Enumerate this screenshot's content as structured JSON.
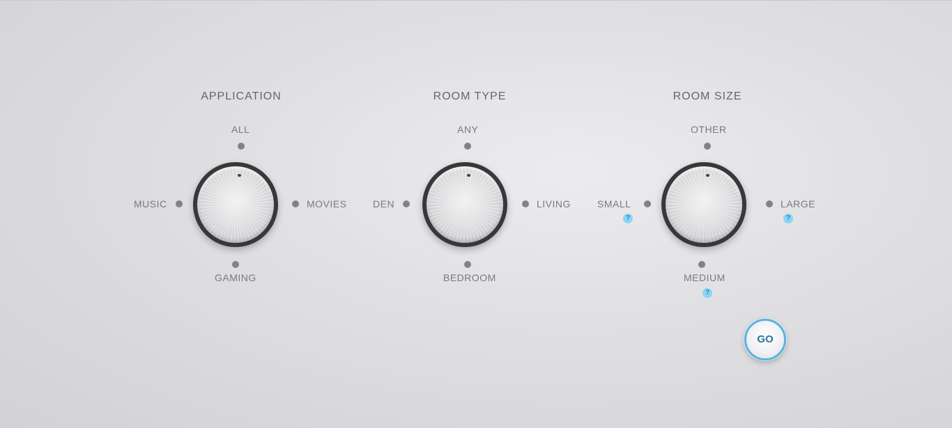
{
  "selectors": [
    {
      "title": "APPLICATION",
      "options": {
        "top": "ALL",
        "left": "MUSIC",
        "right": "MOVIES",
        "bottom": "GAMING"
      },
      "selected": "ALL"
    },
    {
      "title": "ROOM TYPE",
      "options": {
        "top": "ANY",
        "left": "DEN",
        "right": "LIVING",
        "bottom": "BEDROOM"
      },
      "selected": "ANY"
    },
    {
      "title": "ROOM SIZE",
      "options": {
        "top": "OTHER",
        "left": "SMALL",
        "right": "LARGE",
        "bottom": "MEDIUM"
      },
      "selected": "OTHER",
      "help_text": "?"
    }
  ],
  "go_button": {
    "label": "GO"
  },
  "colors": {
    "accent": "#5ab3e0",
    "help_bubble": "#8ad4f5",
    "knob_ring": "#38383a",
    "label": "#7a7a7d"
  }
}
